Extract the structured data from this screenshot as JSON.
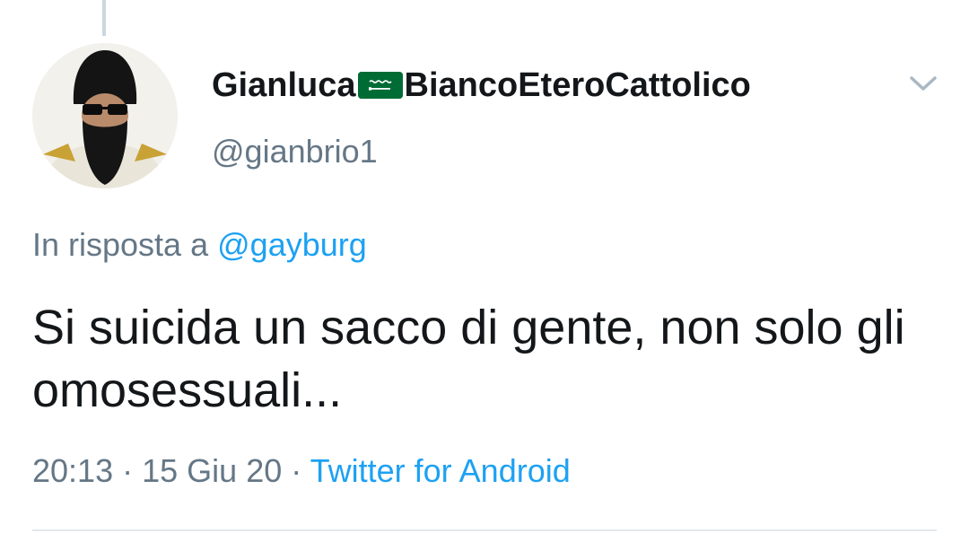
{
  "tweet": {
    "author": {
      "name_part1": "Gianluca",
      "flag_icon": "saudi-arabia-flag-icon",
      "name_part2": "BiancoEteroCattolico",
      "handle": "@gianbrio1"
    },
    "reply": {
      "prefix": "In risposta a",
      "mention": "@gayburg"
    },
    "text": "Si suicida un sacco di gente, non solo gli omosessuali...",
    "meta": {
      "time": "20:13",
      "separator1": "·",
      "date": "15 Giu 20",
      "separator2": "·",
      "source": "Twitter for Android"
    },
    "colors": {
      "link": "#1da1f2",
      "secondary": "#657786",
      "primary": "#14171a",
      "flag_green": "#006c35"
    }
  }
}
